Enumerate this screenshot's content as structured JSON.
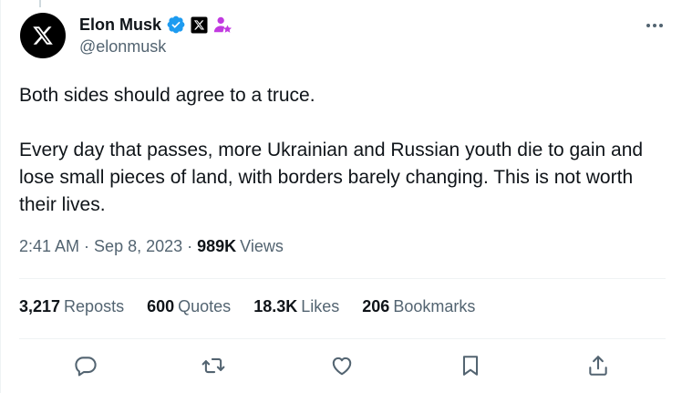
{
  "author": {
    "name": "Elon Musk",
    "handle": "@elonmusk",
    "avatar_icon": "x-logo-icon",
    "badges": [
      "verified-badge-icon",
      "x-affiliate-badge-icon",
      "person-star-badge-icon"
    ]
  },
  "tweet": {
    "paragraphs": [
      "Both sides should agree to a truce.",
      "Every day that passes, more Ukrainian and Russian youth die to gain and lose small pieces of land, with borders barely changing. This is not worth their lives."
    ],
    "time": "2:41 AM",
    "date": "Sep 8, 2023",
    "views_count": "989K",
    "views_label": "Views"
  },
  "stats": [
    {
      "count": "3,217",
      "label": "Reposts"
    },
    {
      "count": "600",
      "label": "Quotes"
    },
    {
      "count": "18.3K",
      "label": "Likes"
    },
    {
      "count": "206",
      "label": "Bookmarks"
    }
  ],
  "actions": [
    "reply-icon",
    "repost-icon",
    "like-icon",
    "bookmark-icon",
    "share-icon"
  ],
  "colors": {
    "text_primary": "#0f1419",
    "text_secondary": "#536471",
    "verified_blue": "#1d9bf0",
    "badge_purple": "#c13ae0",
    "divider": "#eff3f4"
  }
}
